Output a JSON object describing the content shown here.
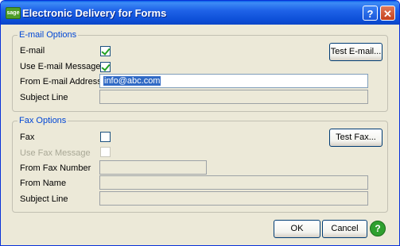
{
  "window": {
    "title": "Electronic Delivery for Forms",
    "app_logo_text": "sage",
    "help_label": "?",
    "close_label": "✕"
  },
  "email_options": {
    "legend": "E-mail Options",
    "email_label": "E-mail",
    "email_checked": true,
    "use_message_label": "Use E-mail Message",
    "use_message_checked": true,
    "from_address_label": "From E-mail Address",
    "from_address_value": "info@abc.com",
    "subject_label": "Subject Line",
    "subject_value": "",
    "test_button": "Test E-mail..."
  },
  "fax_options": {
    "legend": "Fax Options",
    "fax_label": "Fax",
    "fax_checked": false,
    "use_message_label": "Use Fax Message",
    "use_message_checked": false,
    "from_number_label": "From Fax Number",
    "from_name_label": "From Name",
    "subject_label": "Subject Line",
    "test_button": "Test Fax..."
  },
  "footer": {
    "ok": "OK",
    "cancel": "Cancel",
    "help_icon": "?"
  },
  "colors": {
    "title_bar": "#1f63e8",
    "legend": "#0046d5",
    "selection": "#316ac5",
    "face": "#ece9d8"
  }
}
